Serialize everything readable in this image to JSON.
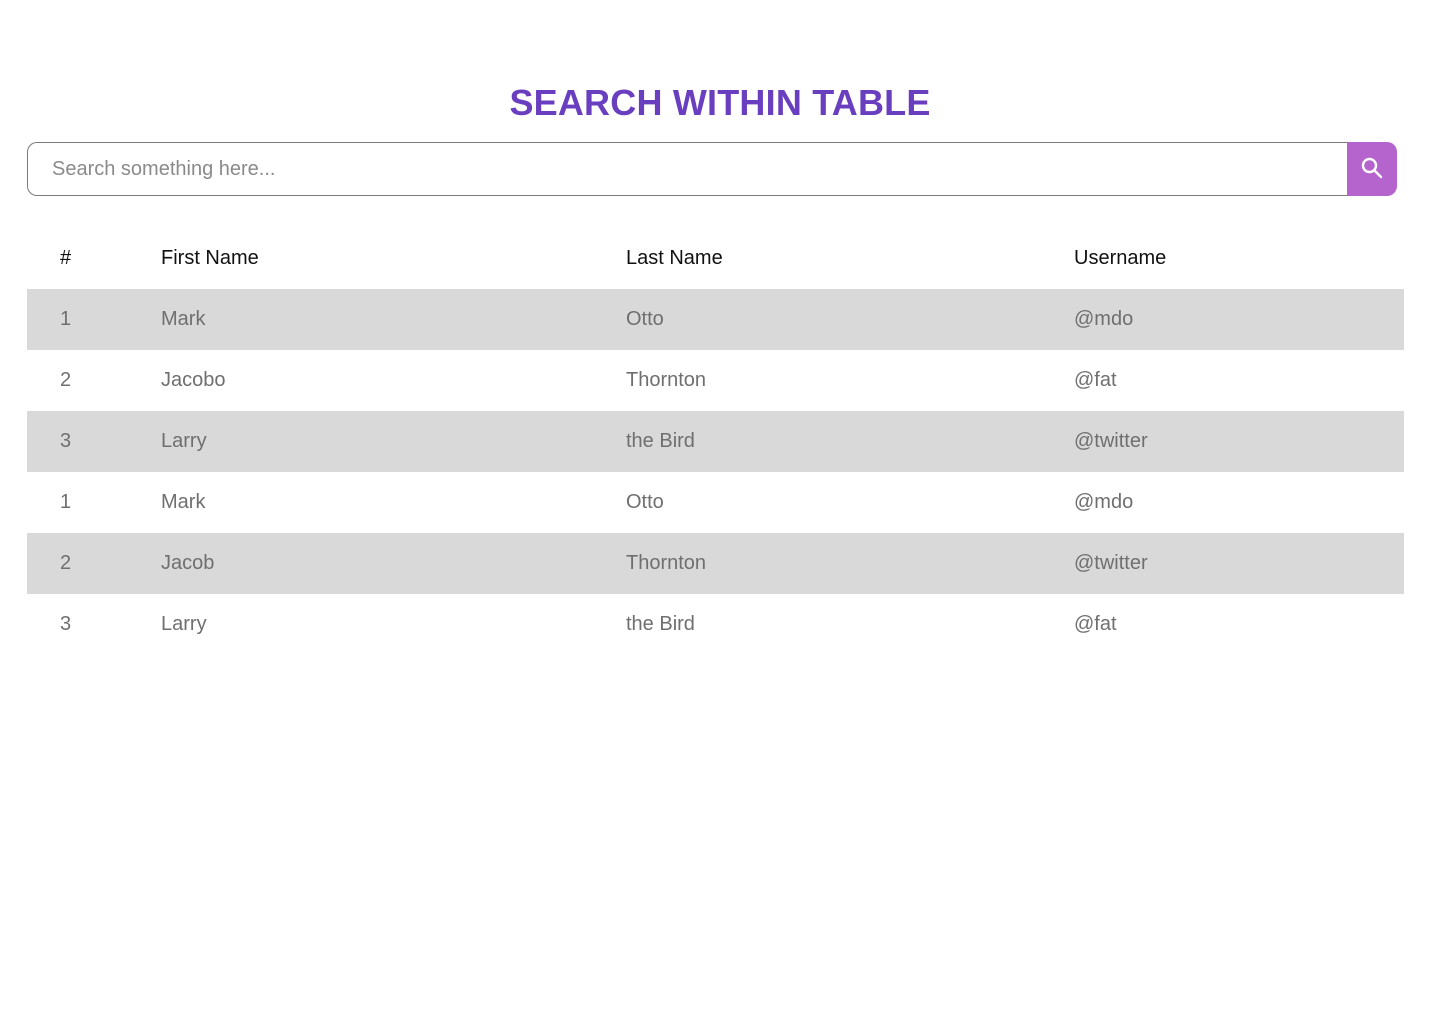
{
  "colors": {
    "title": "#6a3fbf",
    "search_button": "#b464cc",
    "shaded_row": "#d9d9d9"
  },
  "title": "SEARCH WITHIN TABLE",
  "search": {
    "placeholder": "Search something here...",
    "value": "",
    "button_icon": "search-icon"
  },
  "table": {
    "headers": [
      "#",
      "First Name",
      "Last Name",
      "Username"
    ],
    "rows": [
      [
        "1",
        "Mark",
        "Otto",
        "@mdo"
      ],
      [
        "2",
        "Jacobo",
        "Thornton",
        "@fat"
      ],
      [
        "3",
        "Larry",
        "the Bird",
        "@twitter"
      ],
      [
        "1",
        "Mark",
        "Otto",
        "@mdo"
      ],
      [
        "2",
        "Jacob",
        "Thornton",
        "@twitter"
      ],
      [
        "3",
        "Larry",
        "the Bird",
        "@fat"
      ]
    ]
  }
}
